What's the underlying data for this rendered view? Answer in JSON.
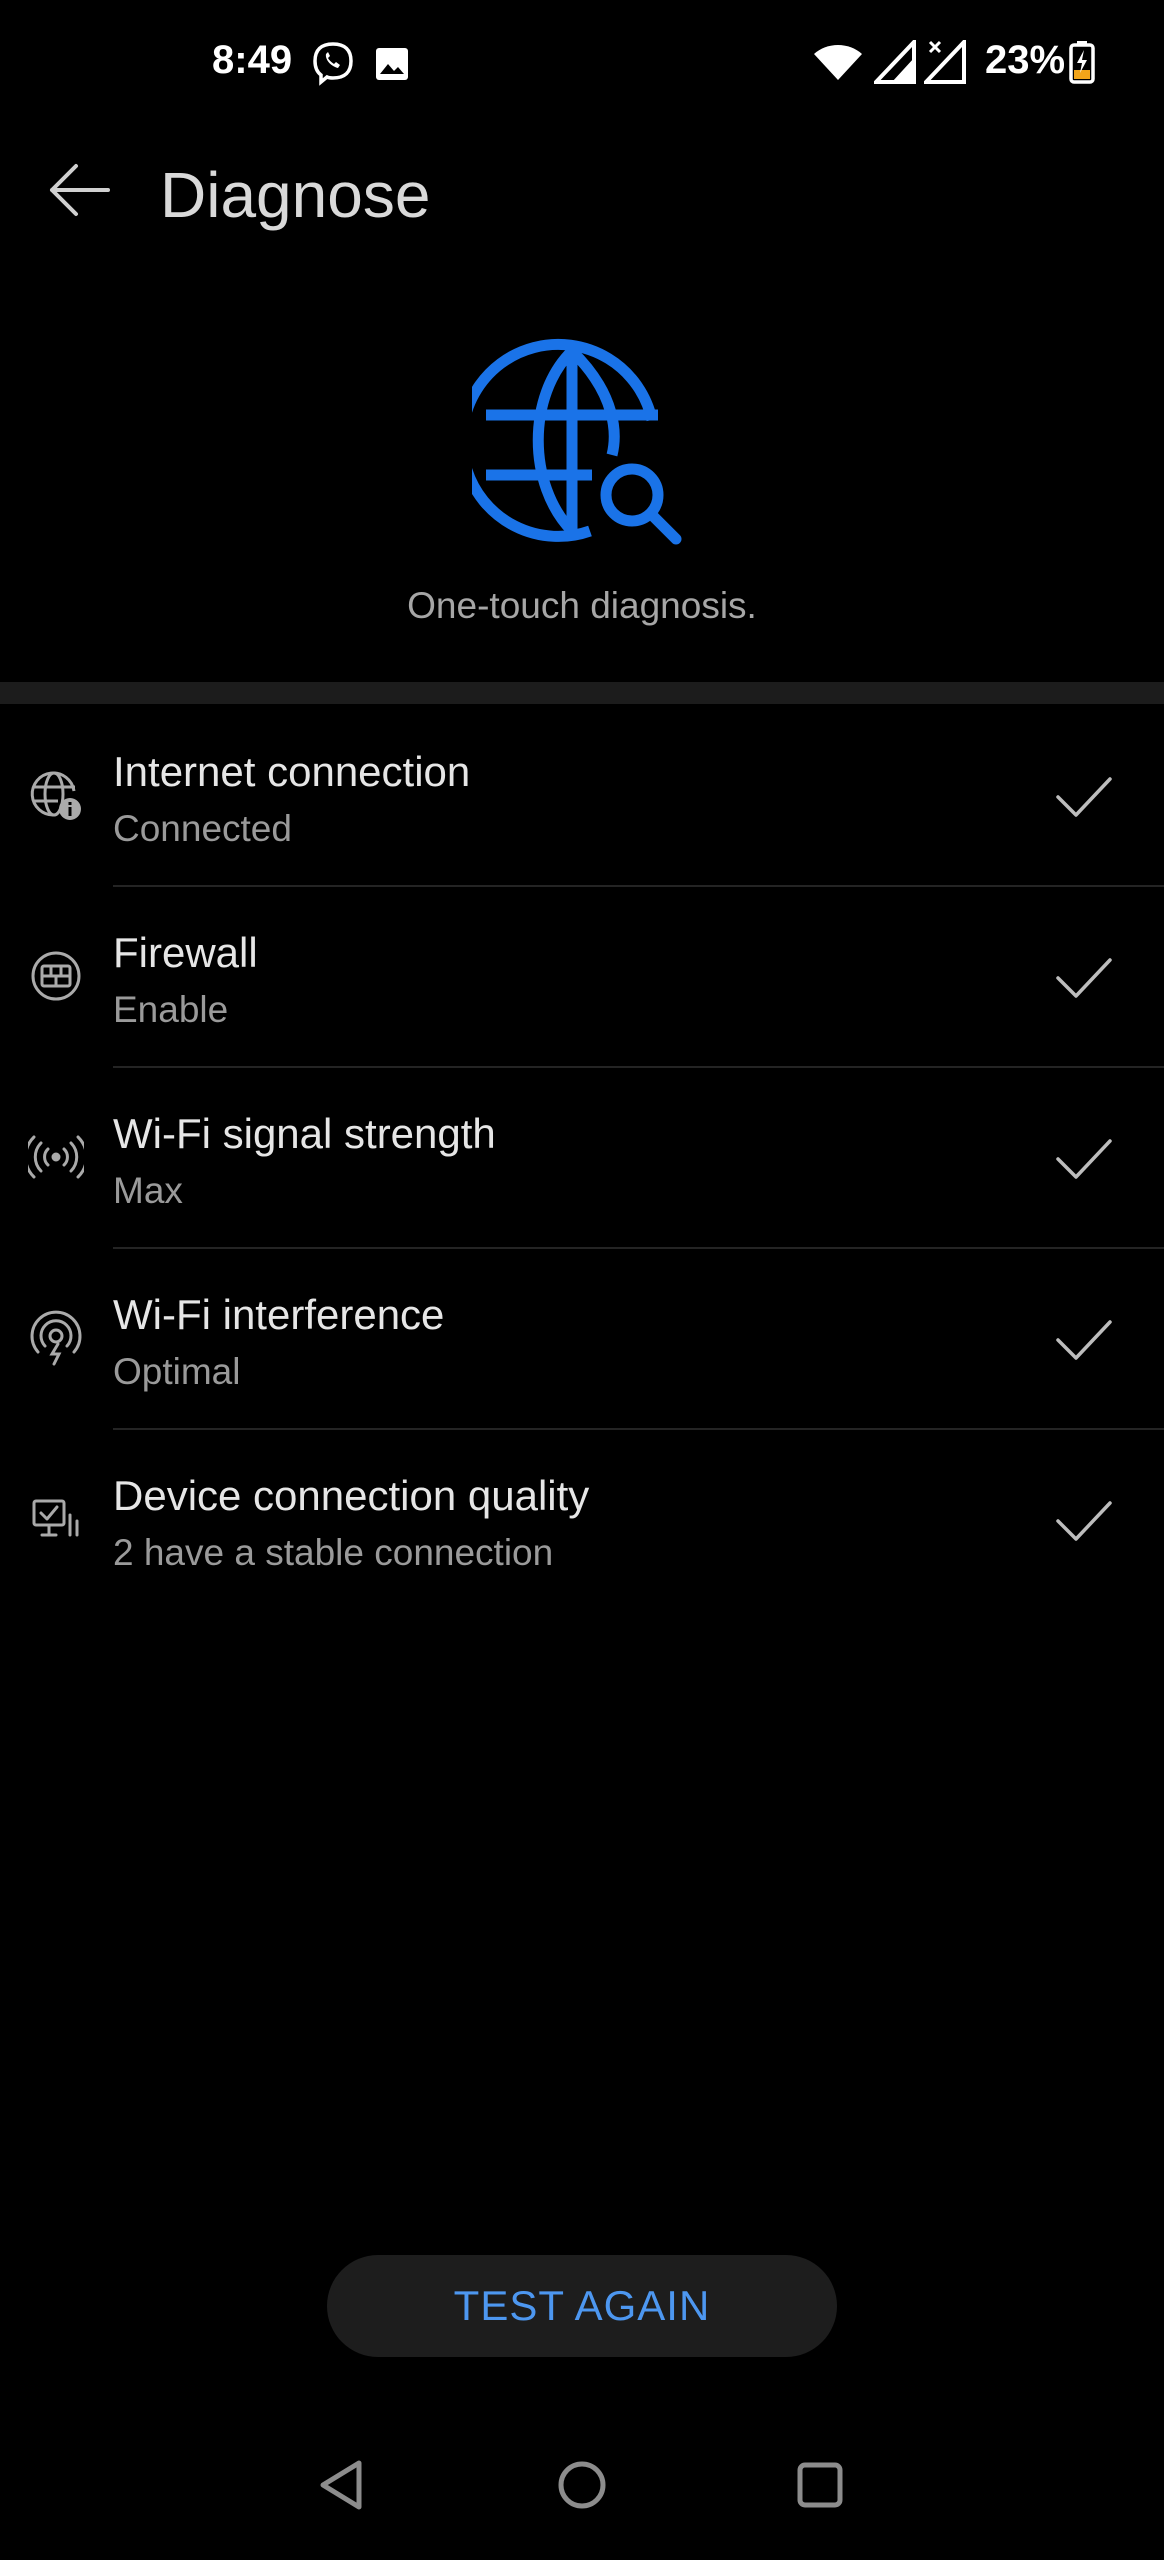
{
  "status_bar": {
    "time": "8:49",
    "battery_percent": "23%",
    "icons": [
      "viber-icon",
      "gallery-icon",
      "wifi-icon",
      "signal-icon",
      "signal-no-sim-icon",
      "battery-charging-icon"
    ]
  },
  "header": {
    "title": "Diagnose",
    "back_icon": "arrow-left-icon"
  },
  "hero": {
    "icon": "globe-search-icon",
    "caption": "One-touch diagnosis.",
    "accent_color": "#1a73e8"
  },
  "items": [
    {
      "icon": "globe-info-icon",
      "title": "Internet connection",
      "status": "Connected",
      "result_icon": "check-icon"
    },
    {
      "icon": "firewall-icon",
      "title": "Firewall",
      "status": "Enable",
      "result_icon": "check-icon"
    },
    {
      "icon": "wifi-signal-icon",
      "title": "Wi-Fi signal strength",
      "status": "Max",
      "result_icon": "check-icon"
    },
    {
      "icon": "wifi-interference-icon",
      "title": "Wi-Fi interference",
      "status": "Optimal",
      "result_icon": "check-icon"
    },
    {
      "icon": "device-quality-icon",
      "title": "Device connection quality",
      "status": "2 have a stable connection",
      "result_icon": "check-icon"
    }
  ],
  "actions": {
    "test_again_label": "TEST AGAIN"
  },
  "nav_bar": {
    "icons": [
      "back-triangle-icon",
      "home-circle-icon",
      "recents-square-icon"
    ]
  },
  "colors": {
    "background": "#000000",
    "button_text": "#4d97f0",
    "check": "#bdbdbd"
  }
}
